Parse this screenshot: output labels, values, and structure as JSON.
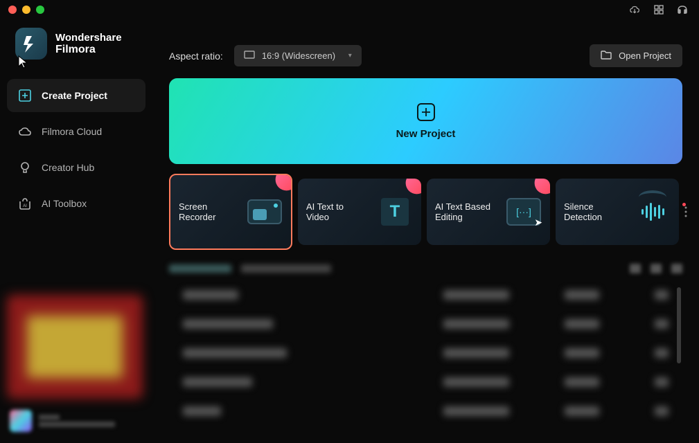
{
  "app": {
    "brand": "Wondershare",
    "name": "Filmora"
  },
  "sidebar": {
    "items": [
      {
        "label": "Create Project"
      },
      {
        "label": "Filmora Cloud"
      },
      {
        "label": "Creator Hub"
      },
      {
        "label": "AI Toolbox"
      }
    ]
  },
  "header": {
    "aspect_label": "Aspect ratio:",
    "aspect_value": "16:9 (Widescreen)",
    "open_project": "Open Project"
  },
  "new_project": {
    "label": "New Project"
  },
  "tools": [
    {
      "label": "Screen Recorder",
      "new": true
    },
    {
      "label": "AI Text to Video",
      "new": true
    },
    {
      "label": "AI Text Based Editing",
      "new": true
    },
    {
      "label": "Silence Detection",
      "new": false
    }
  ]
}
